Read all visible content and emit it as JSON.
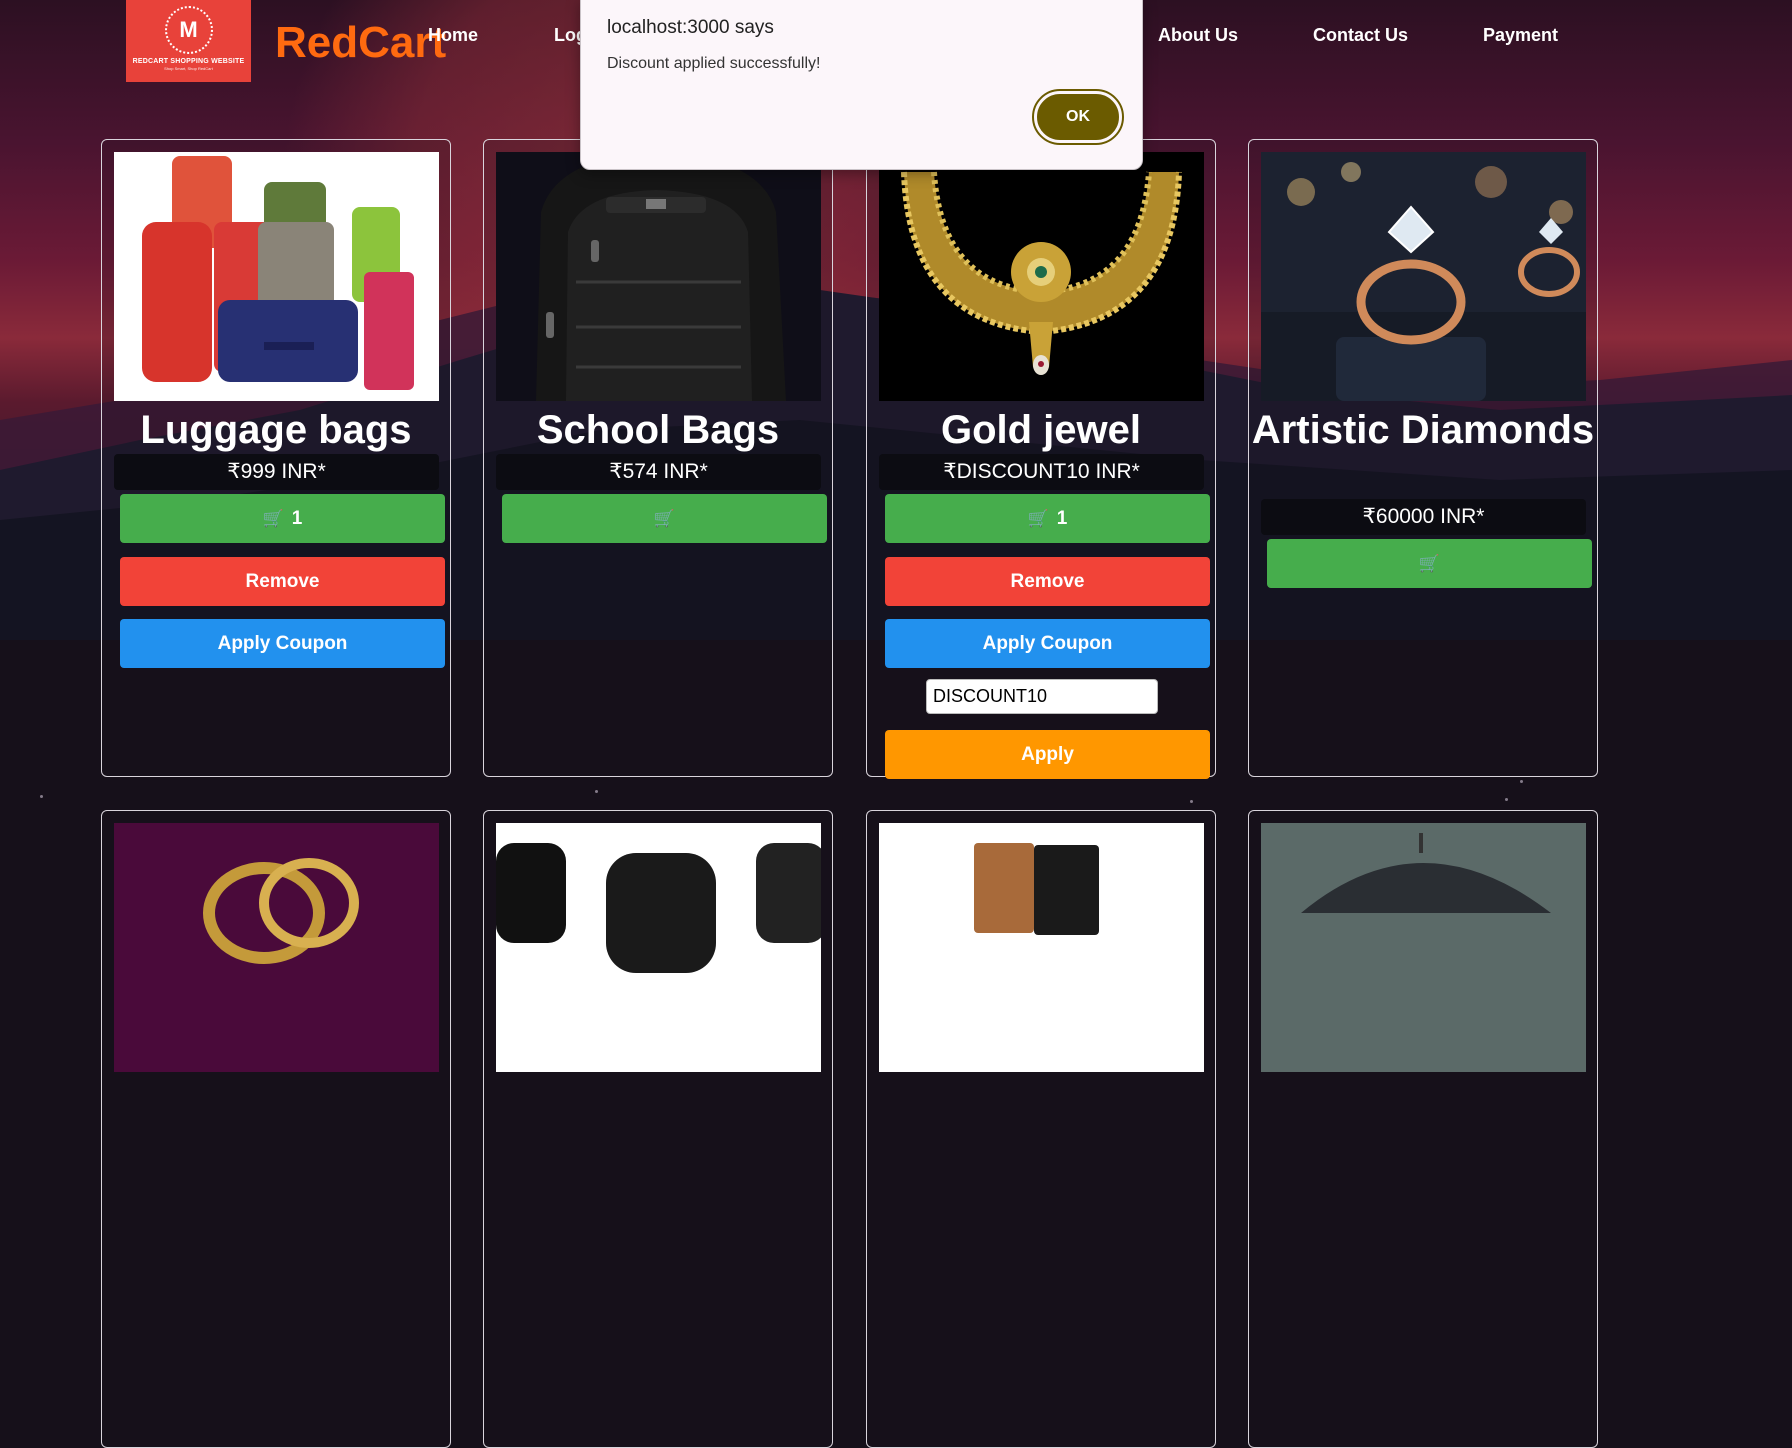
{
  "brand": {
    "logo_text": "REDCART SHOPPING WEBSITE",
    "logo_tagline": "Shop Smart, Shop RedCart",
    "logo_initial": "M",
    "name": "RedCart"
  },
  "nav": {
    "items": [
      "Home",
      "Log",
      "About Us",
      "Contact Us",
      "Payment"
    ]
  },
  "dialog": {
    "title": "localhost:3000 says",
    "message": "Discount applied successfully!",
    "ok_label": "OK"
  },
  "products": [
    {
      "title": "Luggage bags",
      "price": "₹999 INR*",
      "cart_count": "1",
      "remove_label": "Remove",
      "coupon_label": "Apply Coupon"
    },
    {
      "title": "School Bags",
      "price": "₹574 INR*"
    },
    {
      "title": "Gold jewel",
      "price": "₹DISCOUNT10 INR*",
      "cart_count": "1",
      "remove_label": "Remove",
      "coupon_label": "Apply Coupon",
      "coupon_value": "DISCOUNT10",
      "apply_label": "Apply"
    },
    {
      "title": "Artistic Diamonds",
      "price": "₹60000 INR*"
    }
  ],
  "icons": {
    "cart": "cart-icon"
  },
  "colors": {
    "brand": "#ff6a10",
    "logo_bg": "#e8423a",
    "cart_btn": "#46ad4c",
    "remove_btn": "#f24338",
    "coupon_btn": "#2291ee",
    "apply_btn": "#ff9700",
    "ok_btn": "#6b5b00"
  }
}
